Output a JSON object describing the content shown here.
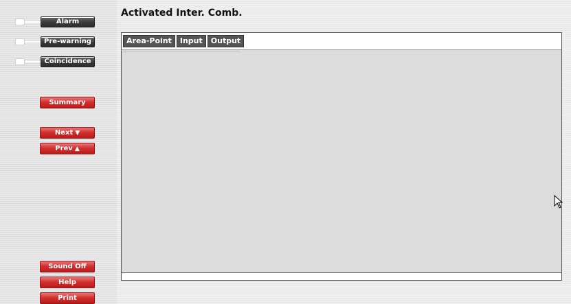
{
  "status": {
    "alarm_label": "Alarm",
    "prewarning_label": "Pre-warning",
    "coincidence_label": "Coincidence"
  },
  "nav": {
    "summary_label": "Summary",
    "next_label": "Next",
    "prev_label": "Prev",
    "sound_off_label": "Sound Off",
    "help_label": "Help",
    "print_label": "Print"
  },
  "page": {
    "title": "Activated Inter. Comb."
  },
  "tabs": [
    {
      "label": "Area-Point"
    },
    {
      "label": "Input"
    },
    {
      "label": "Output"
    }
  ],
  "colors": {
    "accent_red": "#d33131",
    "status_dark": "#3a3a3a",
    "content_bg": "#dcdcdc"
  },
  "icons": {
    "next": "arrow-down-icon",
    "prev": "arrow-up-icon",
    "cursor": "mouse-pointer-icon"
  }
}
